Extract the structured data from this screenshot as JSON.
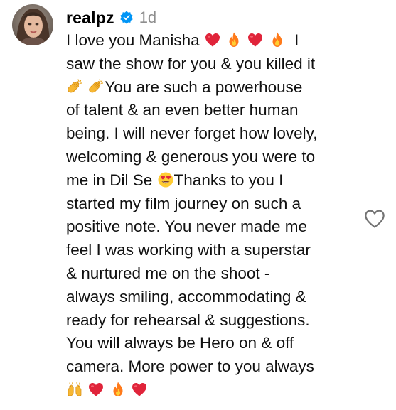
{
  "comment": {
    "username": "realpz",
    "verified_icon": "verified-badge-icon",
    "time": "1d",
    "avatar_icon": "profile-avatar",
    "like_icon": "heart-outline-icon",
    "colors": {
      "verified": "#0095f6",
      "heart": "#e0243a",
      "timestamp": "#8e8e8e"
    },
    "lines": [
      {
        "segments": [
          {
            "t": "I love you Manisha "
          },
          {
            "e": "red-heart"
          },
          {
            "t": " "
          },
          {
            "e": "fire"
          },
          {
            "t": " "
          },
          {
            "e": "red-heart"
          },
          {
            "t": " "
          },
          {
            "e": "fire"
          },
          {
            "t": "  I"
          }
        ]
      },
      {
        "segments": [
          {
            "t": "saw the show for you & you killed it"
          }
        ]
      },
      {
        "segments": [
          {
            "e": "clapping-hands"
          },
          {
            "t": " "
          },
          {
            "e": "clapping-hands"
          },
          {
            "t": "You are such a powerhouse"
          }
        ]
      },
      {
        "segments": [
          {
            "t": "of talent & an even better human"
          }
        ]
      },
      {
        "segments": [
          {
            "t": "being. I will never forget how lovely,"
          }
        ]
      },
      {
        "segments": [
          {
            "t": "welcoming & generous you were to"
          }
        ]
      },
      {
        "segments": [
          {
            "t": "me in Dil Se "
          },
          {
            "e": "heart-eyes"
          },
          {
            "t": "Thanks to you I"
          }
        ]
      },
      {
        "segments": [
          {
            "t": "started my film journey on such a"
          }
        ]
      },
      {
        "segments": [
          {
            "t": "positive note. You never made me"
          }
        ]
      },
      {
        "segments": [
          {
            "t": "feel I was working with a superstar"
          }
        ]
      },
      {
        "segments": [
          {
            "t": "& nurtured me on the shoot -"
          }
        ]
      },
      {
        "segments": [
          {
            "t": "always smiling, accommodating &"
          }
        ]
      },
      {
        "segments": [
          {
            "t": "ready for rehearsal & suggestions."
          }
        ]
      },
      {
        "segments": [
          {
            "t": "You will always be Hero on & off"
          }
        ]
      },
      {
        "segments": [
          {
            "t": "camera. More power to you always"
          }
        ]
      },
      {
        "segments": [
          {
            "e": "raising-hands"
          },
          {
            "t": " "
          },
          {
            "e": "red-heart"
          },
          {
            "t": " "
          },
          {
            "e": "fire"
          },
          {
            "t": " "
          },
          {
            "e": "red-heart"
          }
        ]
      }
    ]
  }
}
